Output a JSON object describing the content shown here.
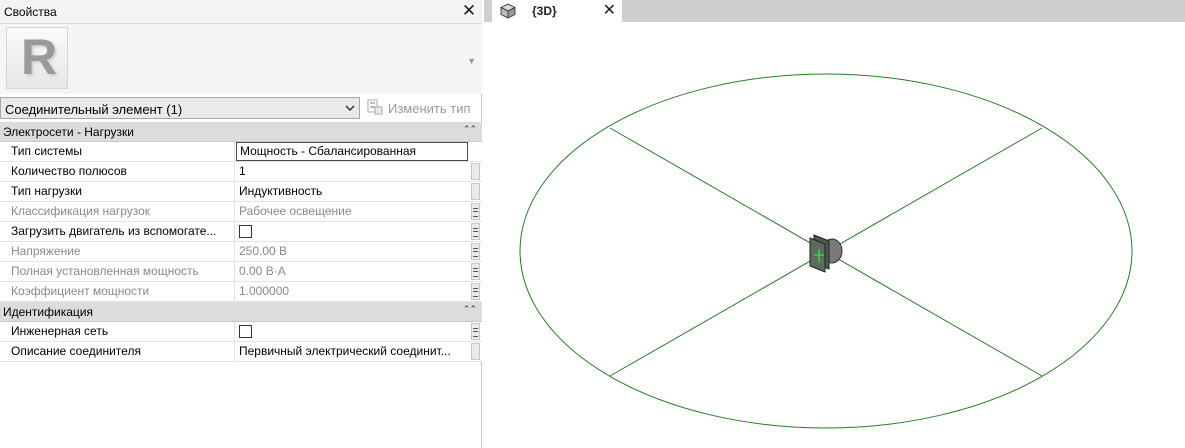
{
  "properties_panel": {
    "title": "Свойства",
    "close_icon": "close-icon",
    "logo_letter": "R",
    "type_selector": {
      "value": "Соединительный элемент (1)",
      "edit_type_label": "Изменить тип"
    },
    "groups": [
      {
        "label": "Электросети - Нагрузки",
        "rows": [
          {
            "name": "Тип системы",
            "value": "Мощность - Сбалансированная",
            "disabled": false,
            "editing": true
          },
          {
            "name": "Количество полюсов",
            "value": "1",
            "disabled": false
          },
          {
            "name": "Тип нагрузки",
            "value": "Индуктивность",
            "disabled": false
          },
          {
            "name": "Классификация нагрузок",
            "value": "Рабочее освещение",
            "disabled": true
          },
          {
            "name": "Загрузить двигатель из вспомогате...",
            "checkbox": false,
            "disabled": false
          },
          {
            "name": "Напряжение",
            "value": "250.00 В",
            "disabled": true
          },
          {
            "name": "Полная установленная мощность",
            "value": "0.00 В·А",
            "disabled": true
          },
          {
            "name": "Коэффициент мощности",
            "value": "1.000000",
            "disabled": true
          }
        ]
      },
      {
        "label": "Идентификация",
        "rows": [
          {
            "name": "Инженерная сеть",
            "checkbox": false,
            "disabled": false
          },
          {
            "name": "Описание соединителя",
            "value": "Первичный электрический соединит...",
            "disabled": false
          }
        ]
      }
    ]
  },
  "view": {
    "tab_label": "{3D}",
    "tab_icon": "cube-icon",
    "line_color": "#2a7a2a",
    "connector_color": "#5a6a5a"
  }
}
